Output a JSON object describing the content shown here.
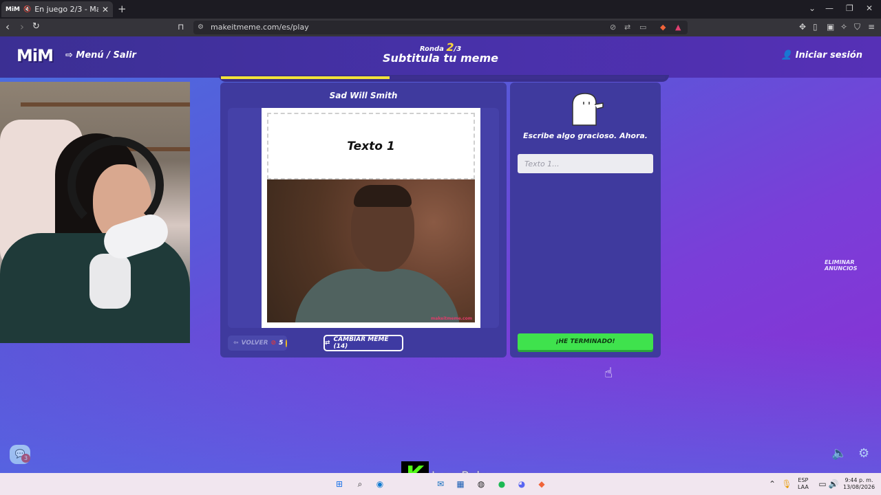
{
  "browser": {
    "tab_favicon": "MiM",
    "tab_title": "En juego 2/3 - Make it Meme",
    "url": "makeitmeme.com/es/play"
  },
  "header": {
    "logo": "MiM",
    "menu_label": "Menú / Salir",
    "round_prefix": "Ronda",
    "round_current": "2",
    "round_total": "/3",
    "title": "Subtitula tu meme",
    "login_label": "Iniciar sesión",
    "progress": 0.38
  },
  "meme": {
    "name": "Sad Will Smith",
    "text_box_1": "Texto 1",
    "watermark": "makeitmeme.com"
  },
  "controls": {
    "back_label": "VOLVER",
    "back_cost": "5",
    "change_label": "CAMBIAR MEME (14)"
  },
  "write": {
    "prompt": "Escribe algo gracioso. Ahora.",
    "input_placeholder": "Texto 1...",
    "input_value": "",
    "done_label": "¡HE TERMINADO!"
  },
  "side": {
    "remove_ads": "ELIMINAR ANUNCIOS",
    "chat_badge": "3"
  },
  "stream": {
    "kick_letter": "K",
    "streamer_name": "JessyBaby"
  },
  "taskbar": {
    "lang_top": "ESP",
    "lang_bottom": "LAA",
    "time": "9:44 p. m.",
    "date": "13/08/2026"
  },
  "colors": {
    "accent_yellow": "#f3e23a",
    "done_green": "#3fe24d",
    "panel": "#3f3a9e"
  }
}
